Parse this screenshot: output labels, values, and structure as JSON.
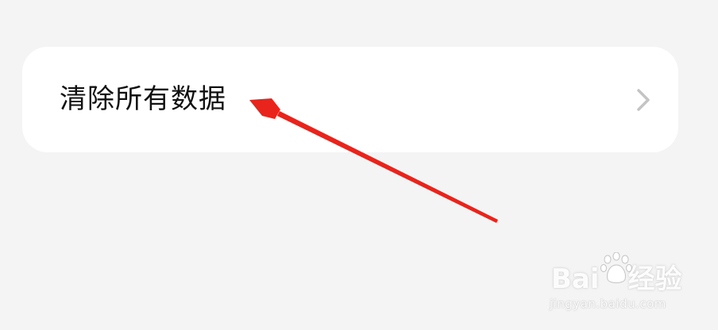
{
  "settings_row": {
    "label": "清除所有数据",
    "chevron_icon": "chevron-right-icon"
  },
  "annotation": {
    "arrow_color": "#e8241c"
  },
  "watermark": {
    "brand_prefix": "Bai",
    "brand_suffix": "经验",
    "url": "jingyan.baidu.com"
  },
  "colors": {
    "background": "#f4f4f4",
    "card": "#ffffff",
    "text": "#111111",
    "chevron": "#c4c4c4"
  }
}
